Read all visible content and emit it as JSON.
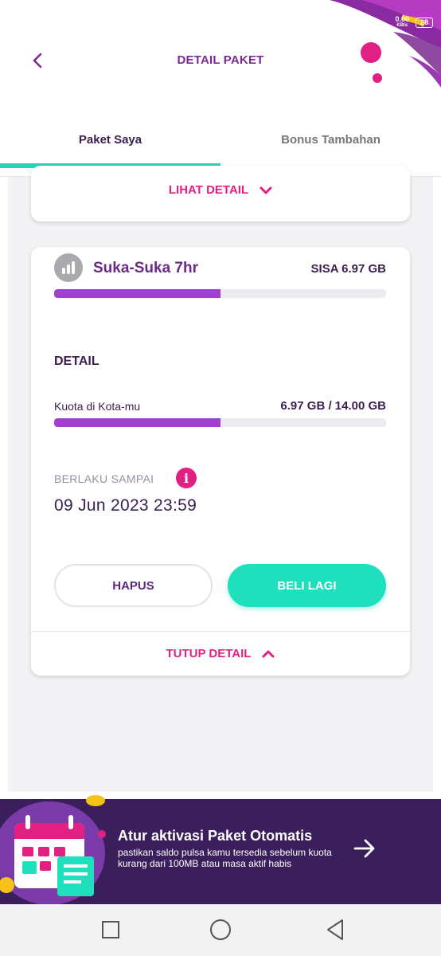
{
  "status_bar": {
    "net_speed": "0.00",
    "net_unit": "KB/s",
    "battery": "28"
  },
  "header": {
    "title": "DETAIL PAKET",
    "back_icon": "chevron-left-icon"
  },
  "tabs": [
    {
      "label": "Paket Saya",
      "active": true
    },
    {
      "label": "Bonus Tambahan",
      "active": false
    }
  ],
  "prev_card": {
    "link_label": "LIHAT DETAIL",
    "link_icon": "chevron-down-icon"
  },
  "package": {
    "icon": "signal-bars-icon",
    "name": "Suka-Suka 7hr",
    "remaining": "SISA 6.97 GB",
    "remaining_fraction": 0.5,
    "detail_heading": "DETAIL",
    "quota_label": "Kuota di Kota-mu",
    "quota_value": "6.97 GB / 14.00 GB",
    "quota_fraction": 0.5,
    "valid_until_label": "BERLAKU SAMPAI",
    "valid_until": "09 Jun 2023 23:59",
    "delete_label": "HAPUS",
    "buy_again_label": "BELI LAGI",
    "close_detail_label": "TUTUP DETAIL",
    "close_icon": "chevron-up-icon"
  },
  "promo": {
    "title": "Atur aktivasi Paket Otomatis",
    "description": "pastikan saldo pulsa kamu tersedia sebelum kuota kurang dari 100MB atau masa aktif habis",
    "arrow_icon": "arrow-right-icon"
  },
  "colors": {
    "primary_purple": "#7a2a90",
    "accent_pink": "#e21f83",
    "accent_teal": "#1fdfbd",
    "progress_purple": "#a040d0",
    "banner_bg": "#3b1f5c"
  }
}
